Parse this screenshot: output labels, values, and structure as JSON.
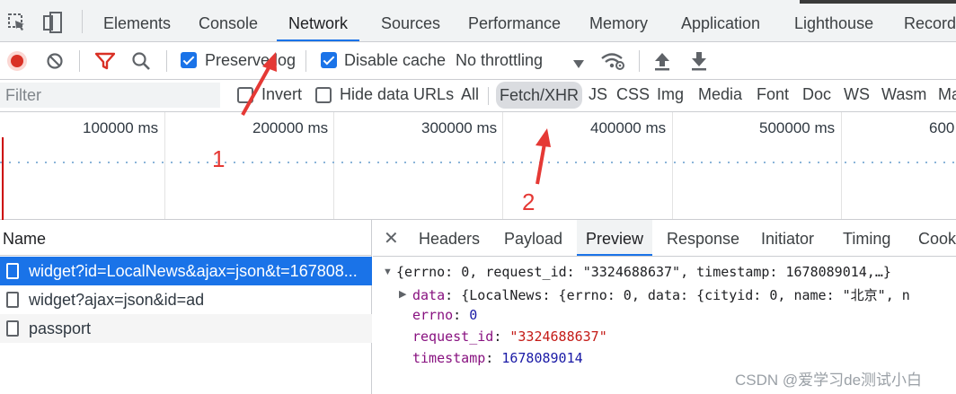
{
  "tabs": [
    "Elements",
    "Console",
    "Network",
    "Sources",
    "Performance",
    "Memory",
    "Application",
    "Lighthouse",
    "Record"
  ],
  "active_tab": "Network",
  "toolbar": {
    "preserve_log": "Preserve log",
    "disable_cache": "Disable cache",
    "throttling": "No throttling"
  },
  "filter": {
    "placeholder": "Filter",
    "invert": "Invert",
    "hide_data_urls": "Hide data URLs",
    "types": [
      "All",
      "Fetch/XHR",
      "JS",
      "CSS",
      "Img",
      "Media",
      "Font",
      "Doc",
      "WS",
      "Wasm",
      "Ma"
    ],
    "active_type": "Fetch/XHR"
  },
  "timeline": {
    "ticks": [
      "100000 ms",
      "200000 ms",
      "300000 ms",
      "400000 ms",
      "500000 ms",
      "600"
    ]
  },
  "request_list": {
    "header": "Name",
    "rows": [
      "widget?id=LocalNews&ajax=json&t=167808...",
      "widget?ajax=json&id=ad",
      "passport"
    ]
  },
  "details": {
    "tabs": [
      "Headers",
      "Payload",
      "Preview",
      "Response",
      "Initiator",
      "Timing",
      "Cook"
    ],
    "active_tab": "Preview",
    "summary": "{errno: 0, request_id: \"3324688637\", timestamp: 1678089014,…}",
    "data_line": {
      "key": "data",
      "value": "{LocalNews: {errno: 0, data: {cityid: 0, name: \"北京\", n"
    },
    "errno": {
      "key": "errno",
      "value": "0"
    },
    "request_id": {
      "key": "request_id",
      "value": "\"3324688637\""
    },
    "timestamp": {
      "key": "timestamp",
      "value": "1678089014"
    }
  },
  "annotations": [
    "1",
    "2"
  ],
  "watermark": "CSDN @爱学习de测试小白",
  "colors": {
    "accent": "#1a73e8",
    "record": "#d93025",
    "annotation": "#e53935"
  }
}
